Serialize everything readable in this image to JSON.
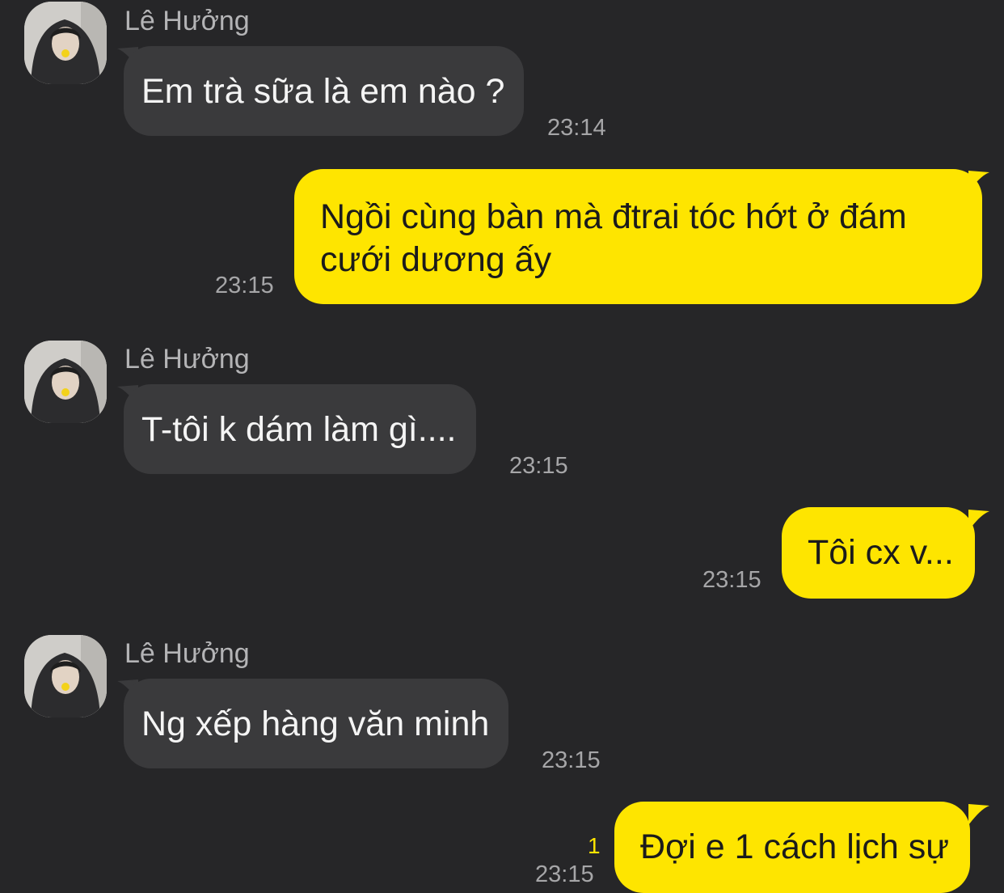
{
  "chat": {
    "colors": {
      "background": "#262628",
      "incoming_bubble": "#3a3a3c",
      "outgoing_bubble": "#fee500",
      "timestamp": "#a6a6a8",
      "sender_name": "#b4b4b6",
      "unread": "#fee500"
    },
    "messages": [
      {
        "direction": "incoming",
        "sender": "Lê Hưởng",
        "avatar_icon": "profile-photo",
        "text": "Em trà sữa là em nào ?",
        "time": "23:14"
      },
      {
        "direction": "outgoing",
        "text": "Ngồi cùng bàn mà đtrai tóc hớt ở đám cưới dương ấy",
        "time": "23:15"
      },
      {
        "direction": "incoming",
        "sender": "Lê Hưởng",
        "avatar_icon": "profile-photo",
        "text": "T-tôi k dám làm gì....",
        "time": "23:15"
      },
      {
        "direction": "outgoing",
        "text": "Tôi cx v...",
        "time": "23:15"
      },
      {
        "direction": "incoming",
        "sender": "Lê Hưởng",
        "avatar_icon": "profile-photo",
        "text": "Ng xếp hàng văn minh",
        "time": "23:15"
      },
      {
        "direction": "outgoing",
        "text": "Đợi e 1 cách lịch sự",
        "time": "23:15",
        "unread_count": "1"
      }
    ]
  }
}
